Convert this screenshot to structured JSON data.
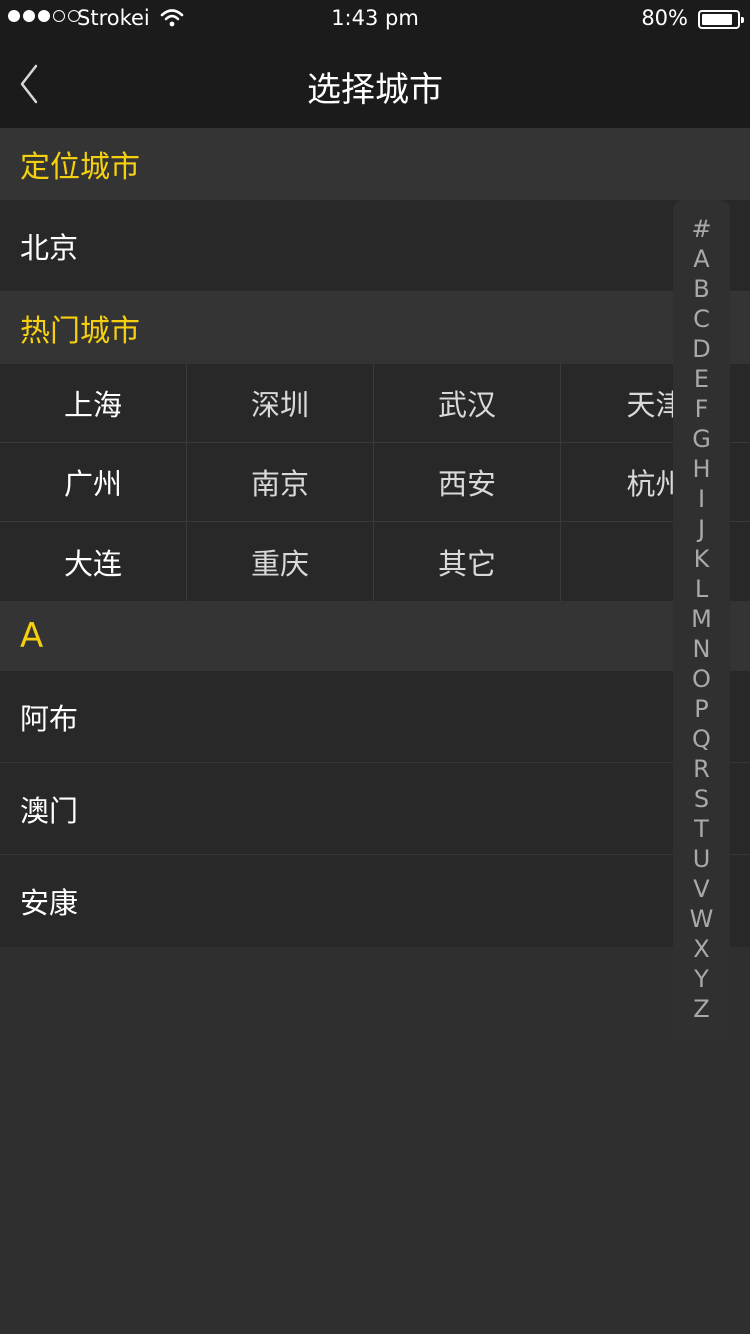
{
  "status_bar": {
    "carrier": "Strokei",
    "time": "1:43 pm",
    "battery": "80%",
    "signal_filled": 3,
    "signal_total": 5,
    "battery_level": 0.8
  },
  "nav": {
    "back_icon": "chevron-left-icon",
    "title": "选择城市"
  },
  "location": {
    "header": "定位城市",
    "city": "北京"
  },
  "hot": {
    "header": "热门城市",
    "rows": [
      [
        "上海",
        "深圳",
        "武汉",
        "天津"
      ],
      [
        "广州",
        "南京",
        "西安",
        "杭州"
      ],
      [
        "大连",
        "重庆",
        "其它",
        ""
      ]
    ]
  },
  "section_a": {
    "header": "A",
    "cities": [
      "阿布",
      "澳门",
      "安康"
    ]
  },
  "index": [
    "#",
    "A",
    "B",
    "C",
    "D",
    "E",
    "F",
    "G",
    "H",
    "I",
    "J",
    "K",
    "L",
    "M",
    "N",
    "O",
    "P",
    "Q",
    "R",
    "S",
    "T",
    "U",
    "V",
    "W",
    "X",
    "Y",
    "Z"
  ],
  "colors": {
    "accent": "#f6d00f",
    "navbar": "#1b1b1b",
    "background": "#2f2f2f"
  }
}
